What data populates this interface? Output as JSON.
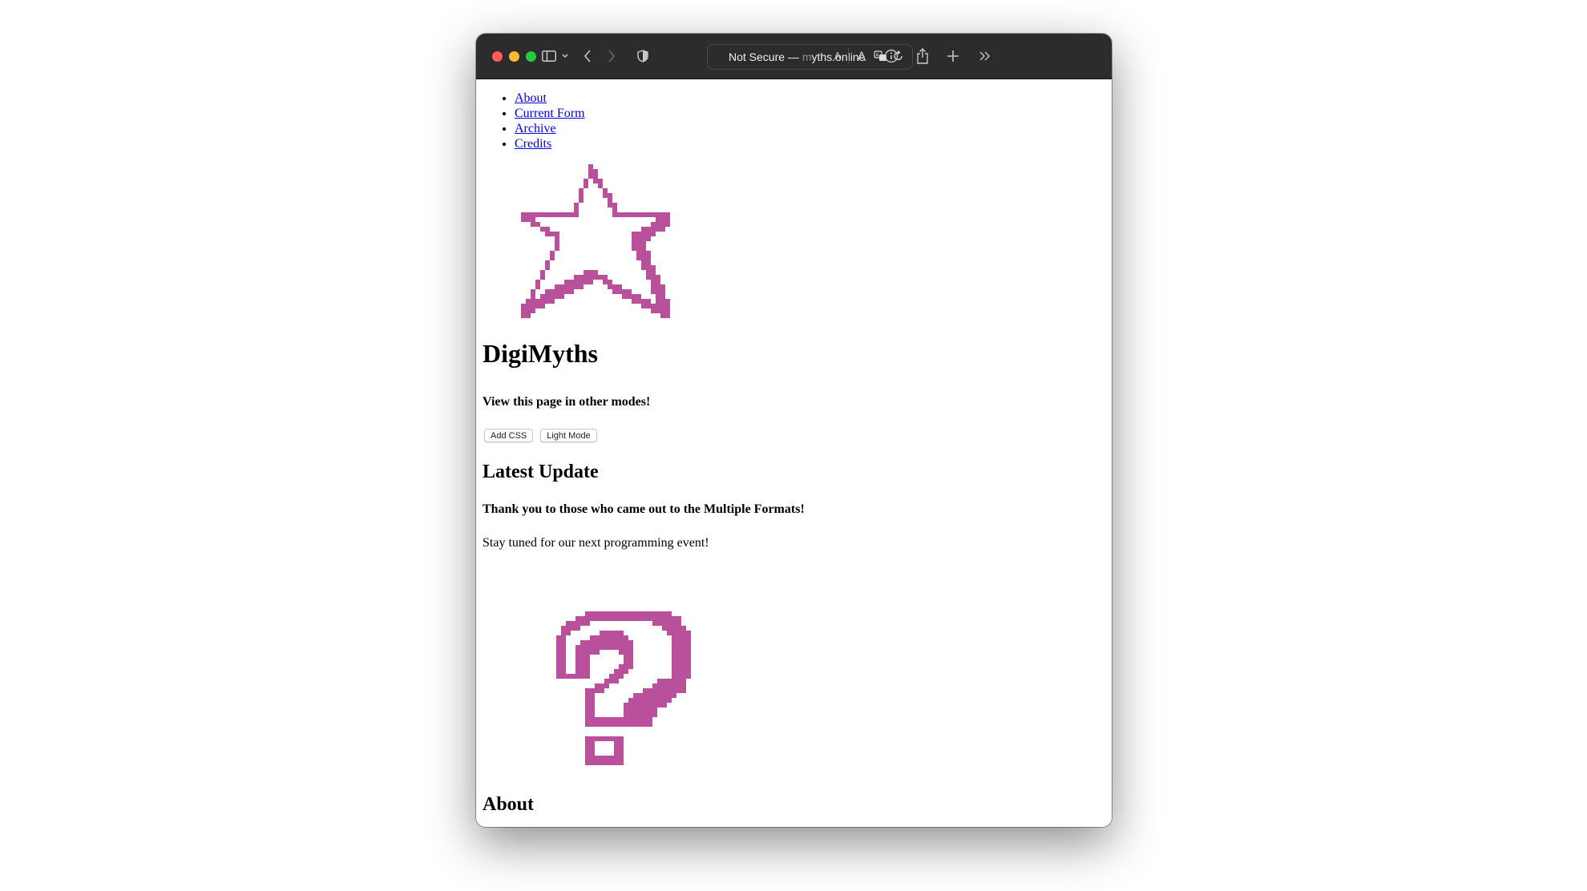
{
  "browser": {
    "address_prefix": "Not Secure —",
    "address_domain_faded": "m",
    "address_domain": "yths.online",
    "icons": [
      "sidebar-icon",
      "chevron-down-icon",
      "back-icon",
      "forward-icon",
      "shield-icon",
      "translate-icon",
      "reload-icon",
      "text-smaller-icon",
      "text-larger-icon",
      "info-icon",
      "share-icon",
      "new-tab-icon",
      "overflow-icon"
    ]
  },
  "nav": {
    "items": [
      {
        "label": "About"
      },
      {
        "label": "Current Form"
      },
      {
        "label": "Archive"
      },
      {
        "label": "Credits"
      }
    ]
  },
  "header": {
    "title": "DigiMyths",
    "subtitle": "View this page in other modes!",
    "buttons": {
      "add_css": "Add CSS",
      "light_mode": "Light Mode"
    }
  },
  "latest": {
    "heading": "Latest Update",
    "thanks": "Thank you to those who came out to the Multiple Formats!",
    "body": "Stay tuned for our next programming event!"
  },
  "about": {
    "heading": "About"
  },
  "colors": {
    "accent": "#b8509b",
    "link": "#0000ee"
  }
}
